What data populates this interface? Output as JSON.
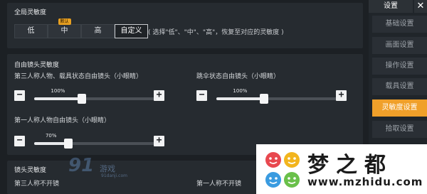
{
  "global": {
    "title": "全局灵敏度",
    "modes": [
      {
        "label": "低"
      },
      {
        "label": "中",
        "badge": "默认"
      },
      {
        "label": "高"
      },
      {
        "label": "自定义",
        "active": true
      }
    ],
    "hint": "( 选择\"低\"、\"中\"、\"高\"，恢复至对应的灵敏度 )"
  },
  "free_camera": {
    "title": "自由镜头灵敏度",
    "sliders": [
      {
        "label": "第三人称人物、载具状态自由镜头（小眼睛）",
        "value_text": "100%",
        "fraction": 0.38
      },
      {
        "label": "跳伞状态自由镜头（小眼睛）",
        "value_text": "100%",
        "fraction": 0.38
      },
      {
        "label": "第一人称人物自由镜头（小眼睛）",
        "value_text": "70%",
        "fraction": 0.27
      }
    ],
    "minus": "−",
    "plus": "+"
  },
  "lens": {
    "title": "镜头灵敏度",
    "left_label": "第三人称不开镜",
    "right_label": "第一人称不开镜"
  },
  "sidebar": {
    "title": "设置",
    "close": "✕",
    "items": [
      {
        "label": "基础设置"
      },
      {
        "label": "画面设置"
      },
      {
        "label": "操作设置"
      },
      {
        "label": "载具设置"
      },
      {
        "label": "灵敏度设置",
        "active": true
      },
      {
        "label": "拾取设置"
      }
    ]
  },
  "watermark": {
    "logo": "91",
    "logo_text": "游戏",
    "logo_url": "91danji.com",
    "brand": "梦之都",
    "brand_url": "www.mzhidu.com"
  },
  "colors": {
    "accent": "#f0a02a",
    "badge": "#e8a020"
  }
}
